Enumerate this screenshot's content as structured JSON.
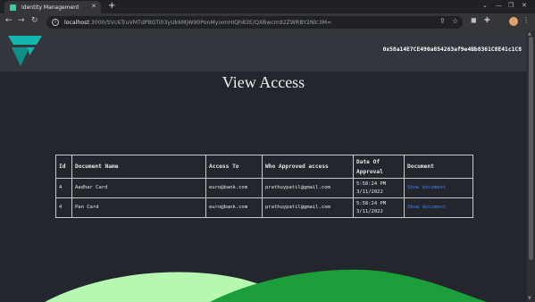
{
  "browser": {
    "tab_title": "Identity Management",
    "tab_close": "✕",
    "new_tab": "+",
    "url_host": "localhost",
    "url_path": ":3000/SVc6TruVMTdPBGTi03yUk6MjW90PonMyixmHIQh83E/QXBwcm92ZWRBY2Nlc3M="
  },
  "header": {
    "wallet_address": "0x58a14E7CE490a854263af9e4Bb8361C8E41c1C8"
  },
  "page": {
    "title": "View Access"
  },
  "table": {
    "headers": {
      "id": "Id",
      "document_name": "Document Name",
      "access_to": "Access To",
      "approved_by": "Who Approved access",
      "date": "Date Of Approval",
      "document": "Document"
    },
    "rows": [
      {
        "id": "4",
        "document_name": "Aadhar Card",
        "access_to": "euro@bank.com",
        "approved_by": "prathuypatil@gmail.com",
        "time": "5:58:24 PM",
        "date": "3/11/2022",
        "document_link": "Show document"
      },
      {
        "id": "4",
        "document_name": "Pan Card",
        "access_to": "euro@bank.com",
        "approved_by": "prathuypatil@gmail.com",
        "time": "5:58:24 PM",
        "date": "3/11/2022",
        "document_link": "Show document"
      }
    ]
  },
  "colors": {
    "wave_light": "#b6f7b2",
    "wave_dark": "#1c9e3a",
    "logo": "#13b7ad",
    "link": "#3b82f6"
  }
}
